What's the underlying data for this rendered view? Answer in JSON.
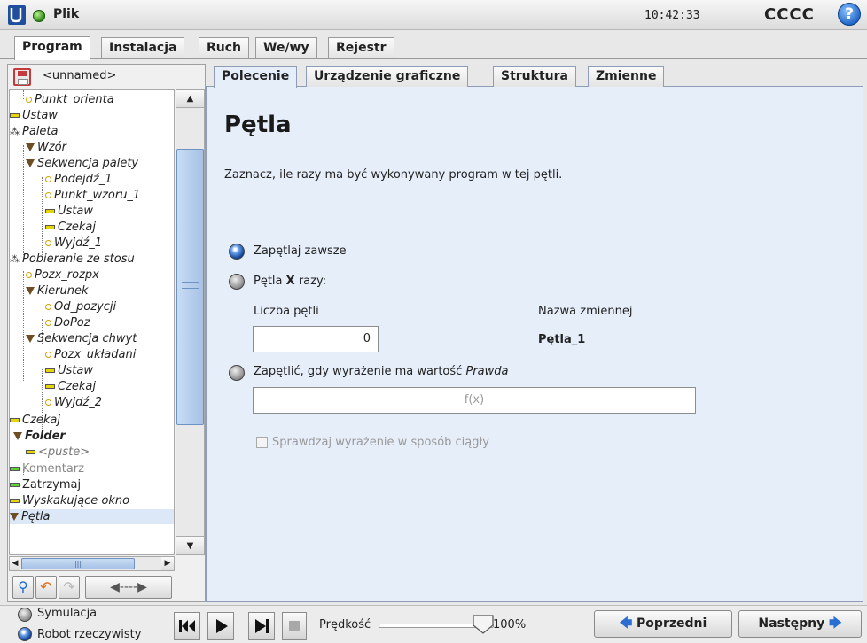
{
  "header": {
    "menu_label": "Plik",
    "clock": "10:42:33",
    "robot_name": "CCCC",
    "help_label": "?"
  },
  "main_tabs": [
    {
      "label": "Program",
      "active": true
    },
    {
      "label": "Instalacja",
      "active": false
    },
    {
      "label": "Ruch",
      "active": false
    },
    {
      "label": "We/wy",
      "active": false
    },
    {
      "label": "Rejestr",
      "active": false
    }
  ],
  "program": {
    "name": "<unnamed>"
  },
  "tree": [
    {
      "label": "Punkt_orienta",
      "icon": "waypoint-icon"
    },
    {
      "label": "Ustaw",
      "icon": "set-icon"
    },
    {
      "label": "Paleta",
      "icon": "pallet-icon"
    },
    {
      "label": "Wzór",
      "icon": "folder-triangle-icon"
    },
    {
      "label": "Sekwencja palety",
      "icon": "folder-triangle-icon"
    },
    {
      "label": "Podejdź_1",
      "icon": "waypoint-icon"
    },
    {
      "label": "Punkt_wzoru_1",
      "icon": "waypoint-icon"
    },
    {
      "label": "Ustaw",
      "icon": "set-icon"
    },
    {
      "label": "Czekaj",
      "icon": "wait-icon"
    },
    {
      "label": "Wyjdź_1",
      "icon": "waypoint-icon"
    },
    {
      "label": "Pobieranie ze stosu",
      "icon": "pallet-icon"
    },
    {
      "label": "Pozx_rozpx",
      "icon": "waypoint-icon"
    },
    {
      "label": "Kierunek",
      "icon": "folder-triangle-icon"
    },
    {
      "label": "Od_pozycji",
      "icon": "waypoint-icon"
    },
    {
      "label": "DoPoz",
      "icon": "waypoint-icon"
    },
    {
      "label": "Sekwencja chwyt",
      "icon": "folder-triangle-icon"
    },
    {
      "label": "Pozx_układani_",
      "icon": "waypoint-icon"
    },
    {
      "label": "Ustaw",
      "icon": "set-icon"
    },
    {
      "label": "Czekaj",
      "icon": "wait-icon"
    },
    {
      "label": "Wyjdź_2",
      "icon": "waypoint-icon"
    },
    {
      "label": "Czekaj",
      "icon": "wait-icon"
    },
    {
      "label": "Folder",
      "icon": "folder-triangle-icon"
    },
    {
      "label": "<puste>",
      "icon": "empty-icon"
    },
    {
      "label": "Komentarz",
      "icon": "comment-icon"
    },
    {
      "label": "Zatrzymaj",
      "icon": "halt-icon"
    },
    {
      "label": "Wyskakujące okno",
      "icon": "popup-icon"
    },
    {
      "label": "Pętla",
      "icon": "loop-icon"
    }
  ],
  "sub_tabs": [
    {
      "label": "Polecenie",
      "active": true
    },
    {
      "label": "Urządzenie graficzne",
      "active": false
    },
    {
      "label": "Struktura",
      "active": false
    },
    {
      "label": "Zmienne",
      "active": false
    }
  ],
  "loop": {
    "title": "Pętla",
    "description": "Zaznacz, ile razy ma być wykonywany program w tej pętli.",
    "option_always": "Zapętlaj zawsze",
    "option_times_prefix": "Pętla ",
    "option_times_x": "X",
    "option_times_suffix": " razy:",
    "count_label": "Liczba pętli",
    "count_value": "0",
    "var_label": "Nazwa zmiennej",
    "var_value": "Pętla_1",
    "option_expr_prefix": "Zapętlić, gdy wyrażenie ma wartość ",
    "option_expr_italic": "Prawda",
    "expr_placeholder": "f(x)",
    "continuous_label": "Sprawdzaj wyrażenie w sposób ciągły",
    "selected_option": "always"
  },
  "footer": {
    "simulation_label": "Symulacja",
    "real_robot_label": "Robot rzeczywisty",
    "speed_label": "Prędkość",
    "speed_value": "100%",
    "prev_label": "Poprzedni",
    "next_label": "Następny"
  },
  "colors": {
    "accent_blue": "#10449a",
    "status_green": "#2e8a16",
    "panel_bg": "#e6eefa"
  }
}
